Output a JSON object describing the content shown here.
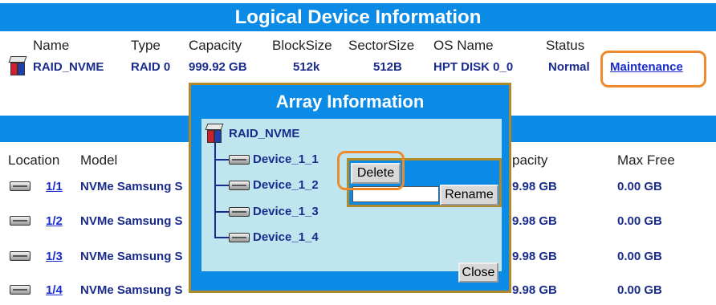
{
  "logical": {
    "title": "Logical Device Information",
    "headers": {
      "name": "Name",
      "type": "Type",
      "capacity": "Capacity",
      "blocksize": "BlockSize",
      "sectorsize": "SectorSize",
      "osname": "OS Name",
      "status": "Status"
    },
    "row": {
      "name": "RAID_NVME",
      "type": "RAID 0",
      "capacity": "999.92 GB",
      "blocksize": "512k",
      "sectorsize": "512B",
      "osname": "HPT DISK 0_0",
      "status": "Normal",
      "action": "Maintenance"
    }
  },
  "physical": {
    "headers": {
      "location": "Location",
      "model": "Model",
      "capacity": "pacity",
      "maxfree": "Max Free"
    },
    "rows": [
      {
        "location": "1/1",
        "model": "NVMe Samsung S",
        "capacity": "9.98 GB",
        "maxfree": "0.00 GB"
      },
      {
        "location": "1/2",
        "model": "NVMe Samsung S",
        "capacity": "9.98 GB",
        "maxfree": "0.00 GB"
      },
      {
        "location": "1/3",
        "model": "NVMe Samsung S",
        "capacity": "9.98 GB",
        "maxfree": "0.00 GB"
      },
      {
        "location": "1/4",
        "model": "NVMe Samsung S",
        "capacity": "9.98 GB",
        "maxfree": "0.00 GB"
      }
    ]
  },
  "dialog": {
    "title": "Array Information",
    "root": "RAID_NVME",
    "devices": [
      "Device_1_1",
      "Device_1_2",
      "Device_1_3",
      "Device_1_4"
    ],
    "close_label": "Close",
    "menu": {
      "delete_label": "Delete",
      "rename_label": "Rename",
      "rename_value": ""
    }
  },
  "colors": {
    "header_blue": "#0b8be6",
    "highlight_orange": "#ef8a2c",
    "text_navy": "#1a2b8c"
  },
  "icons": {
    "array": "raid-cube-icon",
    "disk": "disk-drive-icon"
  }
}
